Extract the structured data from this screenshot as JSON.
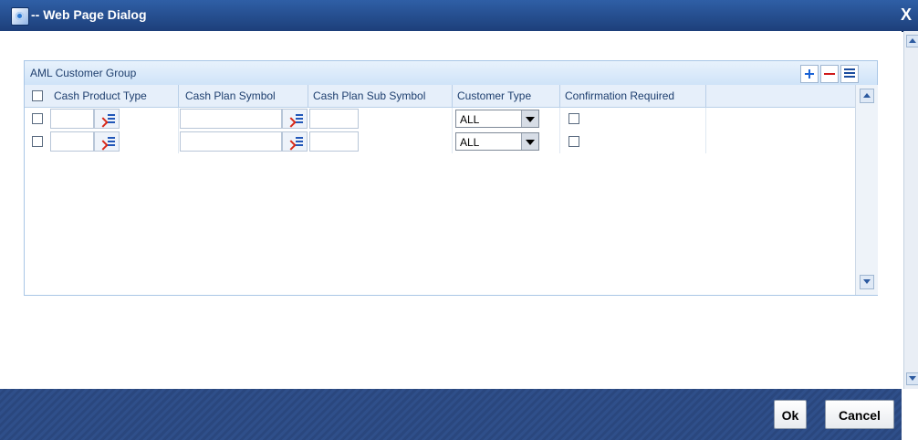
{
  "window": {
    "title": "-- Web Page Dialog",
    "close_label": "X"
  },
  "group": {
    "title": "AML Customer Group",
    "columns": [
      "Cash Product Type",
      "Cash Plan Symbol",
      "Cash Plan Sub Symbol",
      "Customer Type",
      "Confirmation Required"
    ],
    "rows": [
      {
        "cash_product_type": "",
        "cash_plan_symbol": "",
        "cash_plan_sub_symbol": "",
        "customer_type": "ALL",
        "confirmation_required": false
      },
      {
        "cash_product_type": "",
        "cash_plan_symbol": "",
        "cash_plan_sub_symbol": "",
        "customer_type": "ALL",
        "confirmation_required": false
      }
    ]
  },
  "buttons": {
    "ok": "Ok",
    "cancel": "Cancel"
  },
  "icons": {
    "window": "ie-window-icon",
    "add": "add-row-icon",
    "delete": "delete-row-icon",
    "list": "list-view-icon",
    "lov": "lov-search-icon"
  },
  "colors": {
    "titlebar": "#2f5fa6",
    "footer": "#2f4f8a",
    "group_border": "#a9c6e6",
    "header_bg": "#e6effa"
  }
}
